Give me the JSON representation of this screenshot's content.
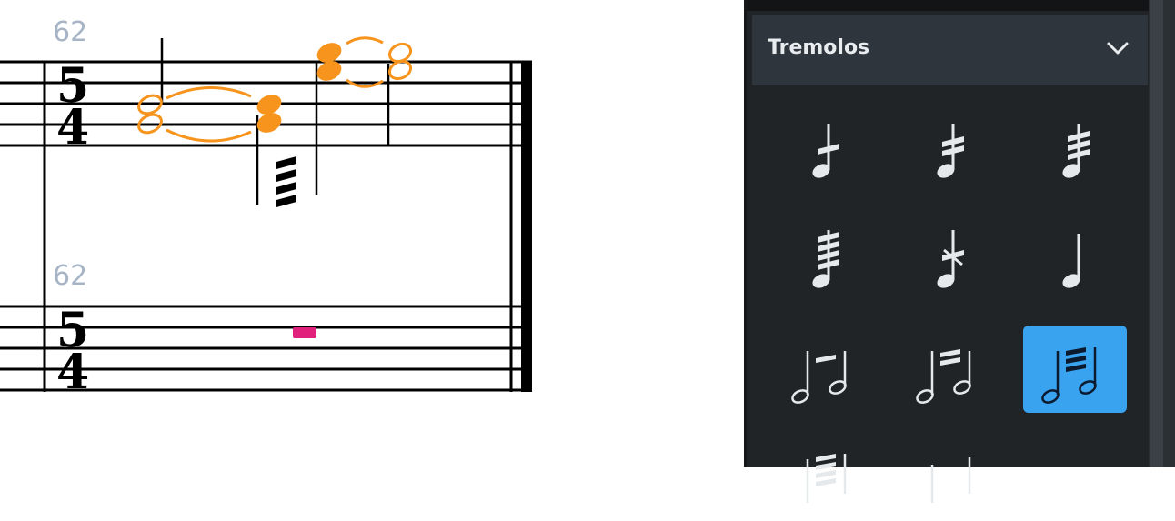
{
  "score": {
    "upper_bar_number": "62",
    "lower_bar_number": "62",
    "time_signature": {
      "numerator": "5",
      "denominator": "4"
    }
  },
  "panel": {
    "section_title": "Tremolos",
    "tiles": [
      {
        "name": "tremolo-1-stroke-icon",
        "selected": false
      },
      {
        "name": "tremolo-2-strokes-icon",
        "selected": false
      },
      {
        "name": "tremolo-3-strokes-icon",
        "selected": false
      },
      {
        "name": "tremolo-4-strokes-icon",
        "selected": false
      },
      {
        "name": "buzz-roll-icon",
        "selected": false
      },
      {
        "name": "remove-tremolo-icon",
        "selected": false
      },
      {
        "name": "multi-note-tremolo-1-stroke-icon",
        "selected": false
      },
      {
        "name": "multi-note-tremolo-2-strokes-icon",
        "selected": false
      },
      {
        "name": "multi-note-tremolo-3-strokes-icon",
        "selected": true
      },
      {
        "name": "multi-note-tremolo-4-strokes-icon",
        "selected": false
      },
      {
        "name": "remove-multi-note-tremolo-icon",
        "selected": false
      }
    ],
    "colors": {
      "accent": "#3aa3f0",
      "panel_bg": "#202427",
      "header_bg": "#2f353c",
      "icon": "#e6e9ec",
      "selection_note": "#f7941d",
      "rest_highlight": "#e0207a"
    }
  }
}
